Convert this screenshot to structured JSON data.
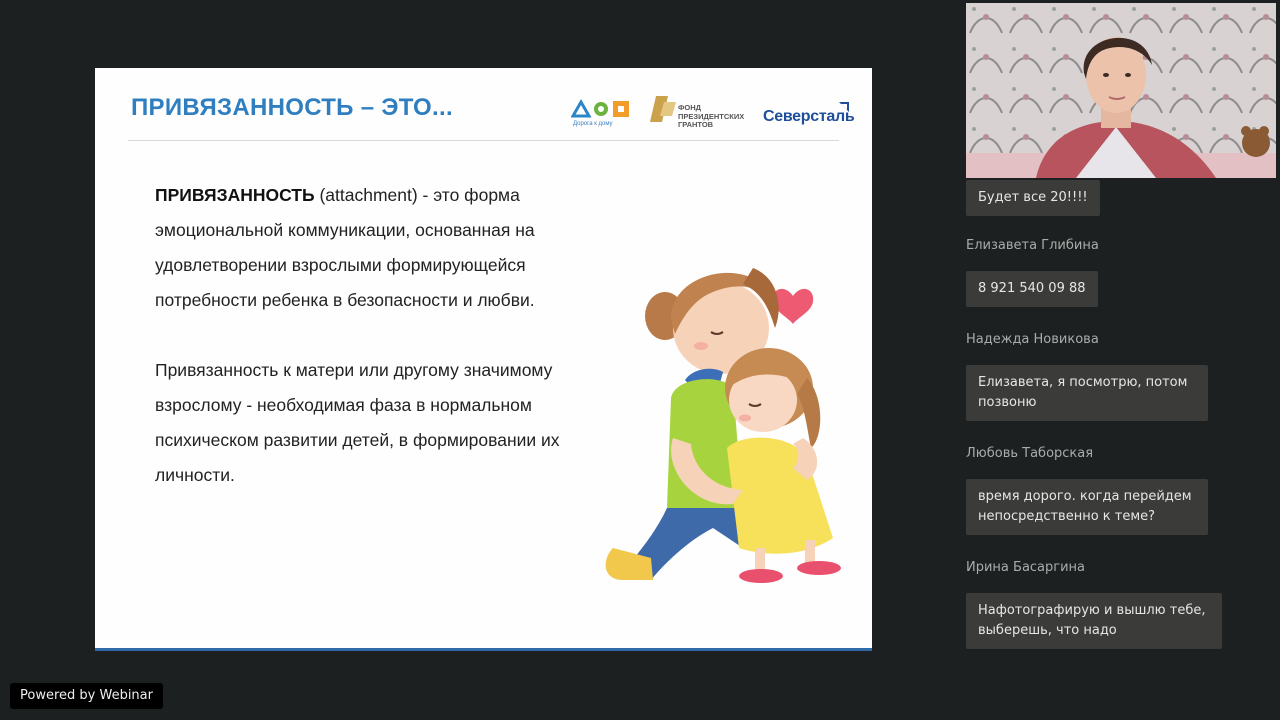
{
  "slide": {
    "title": "ПРИВЯЗАННОСТЬ – ЭТО...",
    "logos": {
      "doroga_caption": "Дорога к дому",
      "fond_text": "ФОНД\nПРЕЗИДЕНТСКИХ\nГРАНТОВ",
      "severstal": "Северсталь"
    },
    "para1_bold": "ПРИВЯЗАННОСТЬ",
    "para1_rest": " (attachment) - это форма эмоциональной коммуникации, основанная на удовлетворении взрослыми формирующейся потребности ребенка в безопасности и любви.",
    "para2": "Привязанность к матери или другому значимому взрослому - необходимая фаза в нормальном психическом развитии детей, в формировании их личности."
  },
  "chat": {
    "messages": [
      {
        "author": "",
        "text": "Будет все 20!!!!"
      },
      {
        "author": "Елизавета Глибина",
        "text": "8 921 540 09 88"
      },
      {
        "author": "Надежда Новикова",
        "text": "Елизавета, я посмотрю, потом позвоню"
      },
      {
        "author": "Любовь Таборская",
        "text": "время дорого. когда перейдем непосредственно к теме?"
      },
      {
        "author": "Ирина Басаргина",
        "text": "Нафотографирую и вышлю тебе, выберешь, что надо"
      }
    ]
  },
  "footer": {
    "powered_by": "Powered by Webinar"
  }
}
